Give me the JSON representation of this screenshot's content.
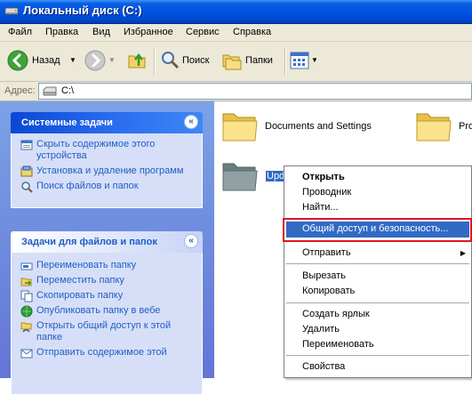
{
  "window": {
    "title": "Локальный диск (C:)"
  },
  "menu": {
    "items": [
      "Файл",
      "Правка",
      "Вид",
      "Избранное",
      "Сервис",
      "Справка"
    ]
  },
  "toolbar": {
    "back_label": "Назад",
    "search_label": "Поиск",
    "folders_label": "Папки"
  },
  "address": {
    "label": "Адрес:",
    "value": "C:\\"
  },
  "system_tasks": {
    "title": "Системные задачи",
    "items": [
      {
        "label": "Скрыть содержимое этого устройства",
        "icon": "hide-contents-icon"
      },
      {
        "label": "Установка и удаление программ",
        "icon": "add-remove-programs-icon"
      },
      {
        "label": "Поиск файлов и папок",
        "icon": "search-icon"
      }
    ]
  },
  "file_tasks": {
    "title": "Задачи для файлов и папок",
    "items": [
      {
        "label": "Переименовать папку",
        "icon": "rename-icon"
      },
      {
        "label": "Переместить папку",
        "icon": "move-icon"
      },
      {
        "label": "Скопировать папку",
        "icon": "copy-icon"
      },
      {
        "label": "Опубликовать папку в вебе",
        "icon": "publish-web-icon"
      },
      {
        "label": "Открыть общий доступ к этой папке",
        "icon": "share-icon"
      },
      {
        "label": "Отправить содержимое этой",
        "icon": "email-icon"
      }
    ]
  },
  "folders": [
    {
      "name": "Documents and Settings"
    },
    {
      "name": "Pro"
    },
    {
      "name": "Upda"
    }
  ],
  "context_menu": {
    "items": [
      {
        "label": "Открыть",
        "bold": true
      },
      {
        "label": "Проводник"
      },
      {
        "label": "Найти..."
      },
      {
        "label": "Общий доступ и безопасность...",
        "highlighted": true
      },
      {
        "label": "Отправить",
        "submenu": true
      },
      {
        "label": "Вырезать"
      },
      {
        "label": "Копировать"
      },
      {
        "label": "Создать ярлык"
      },
      {
        "label": "Удалить"
      },
      {
        "label": "Переименовать"
      },
      {
        "label": "Свойства"
      }
    ]
  },
  "colors": {
    "titlebar": "#0054e3",
    "selection": "#316ac5",
    "highlight_box": "#e0151c",
    "task_link": "#215dc6"
  }
}
